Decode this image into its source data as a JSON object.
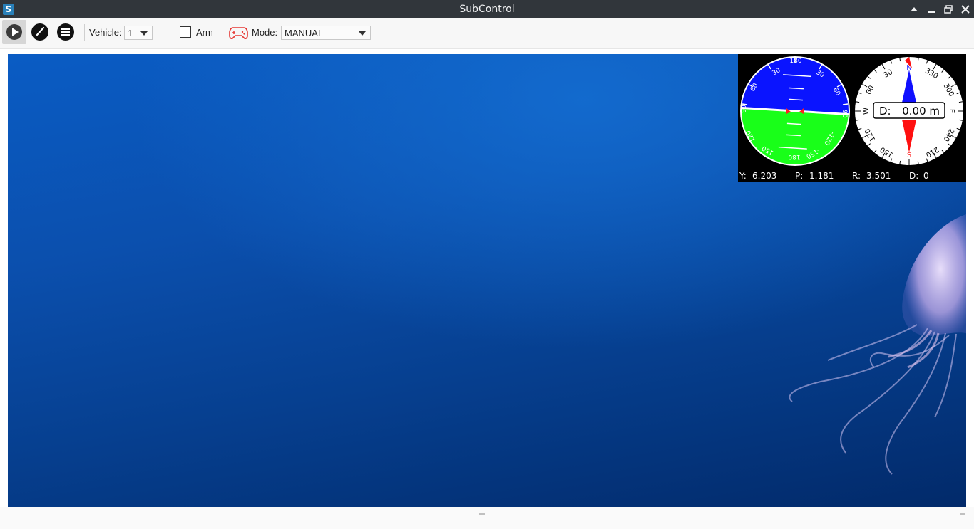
{
  "window": {
    "title": "SubControl",
    "app_icon_letter": "S"
  },
  "toolbar": {
    "buttons": [
      "play-icon",
      "gauge-icon",
      "menu-icon"
    ],
    "vehicle_label": "Vehicle:",
    "vehicle_value": "1",
    "arm_label": "Arm",
    "arm_checked": false,
    "mode_label": "Mode:",
    "mode_value": "MANUAL",
    "gamepad_color": "#e53935"
  },
  "attitude": {
    "sky_color": "#0a14ff",
    "ground_color": "#19ff19",
    "roll_labels": [
      "30",
      "60",
      "90",
      "90",
      "60",
      "30"
    ],
    "pitch_labels": [
      "30",
      "60",
      "90",
      "120",
      "150",
      "180",
      "-30",
      "-60",
      "-90",
      "-120",
      "-150"
    ]
  },
  "compass": {
    "north": "N",
    "east": "E",
    "south": "S",
    "west": "W",
    "bearing_labels": [
      "30",
      "60",
      "120",
      "150",
      "210",
      "240",
      "300",
      "330"
    ],
    "depth_prefix": "D:",
    "depth_value": "0.00 m"
  },
  "readouts": {
    "yaw_label": "Y:",
    "yaw": "6.203",
    "pitch_label": "P:",
    "pitch": "1.181",
    "roll_label": "R:",
    "roll": "3.501",
    "depth_label": "D:",
    "depth": "0"
  }
}
